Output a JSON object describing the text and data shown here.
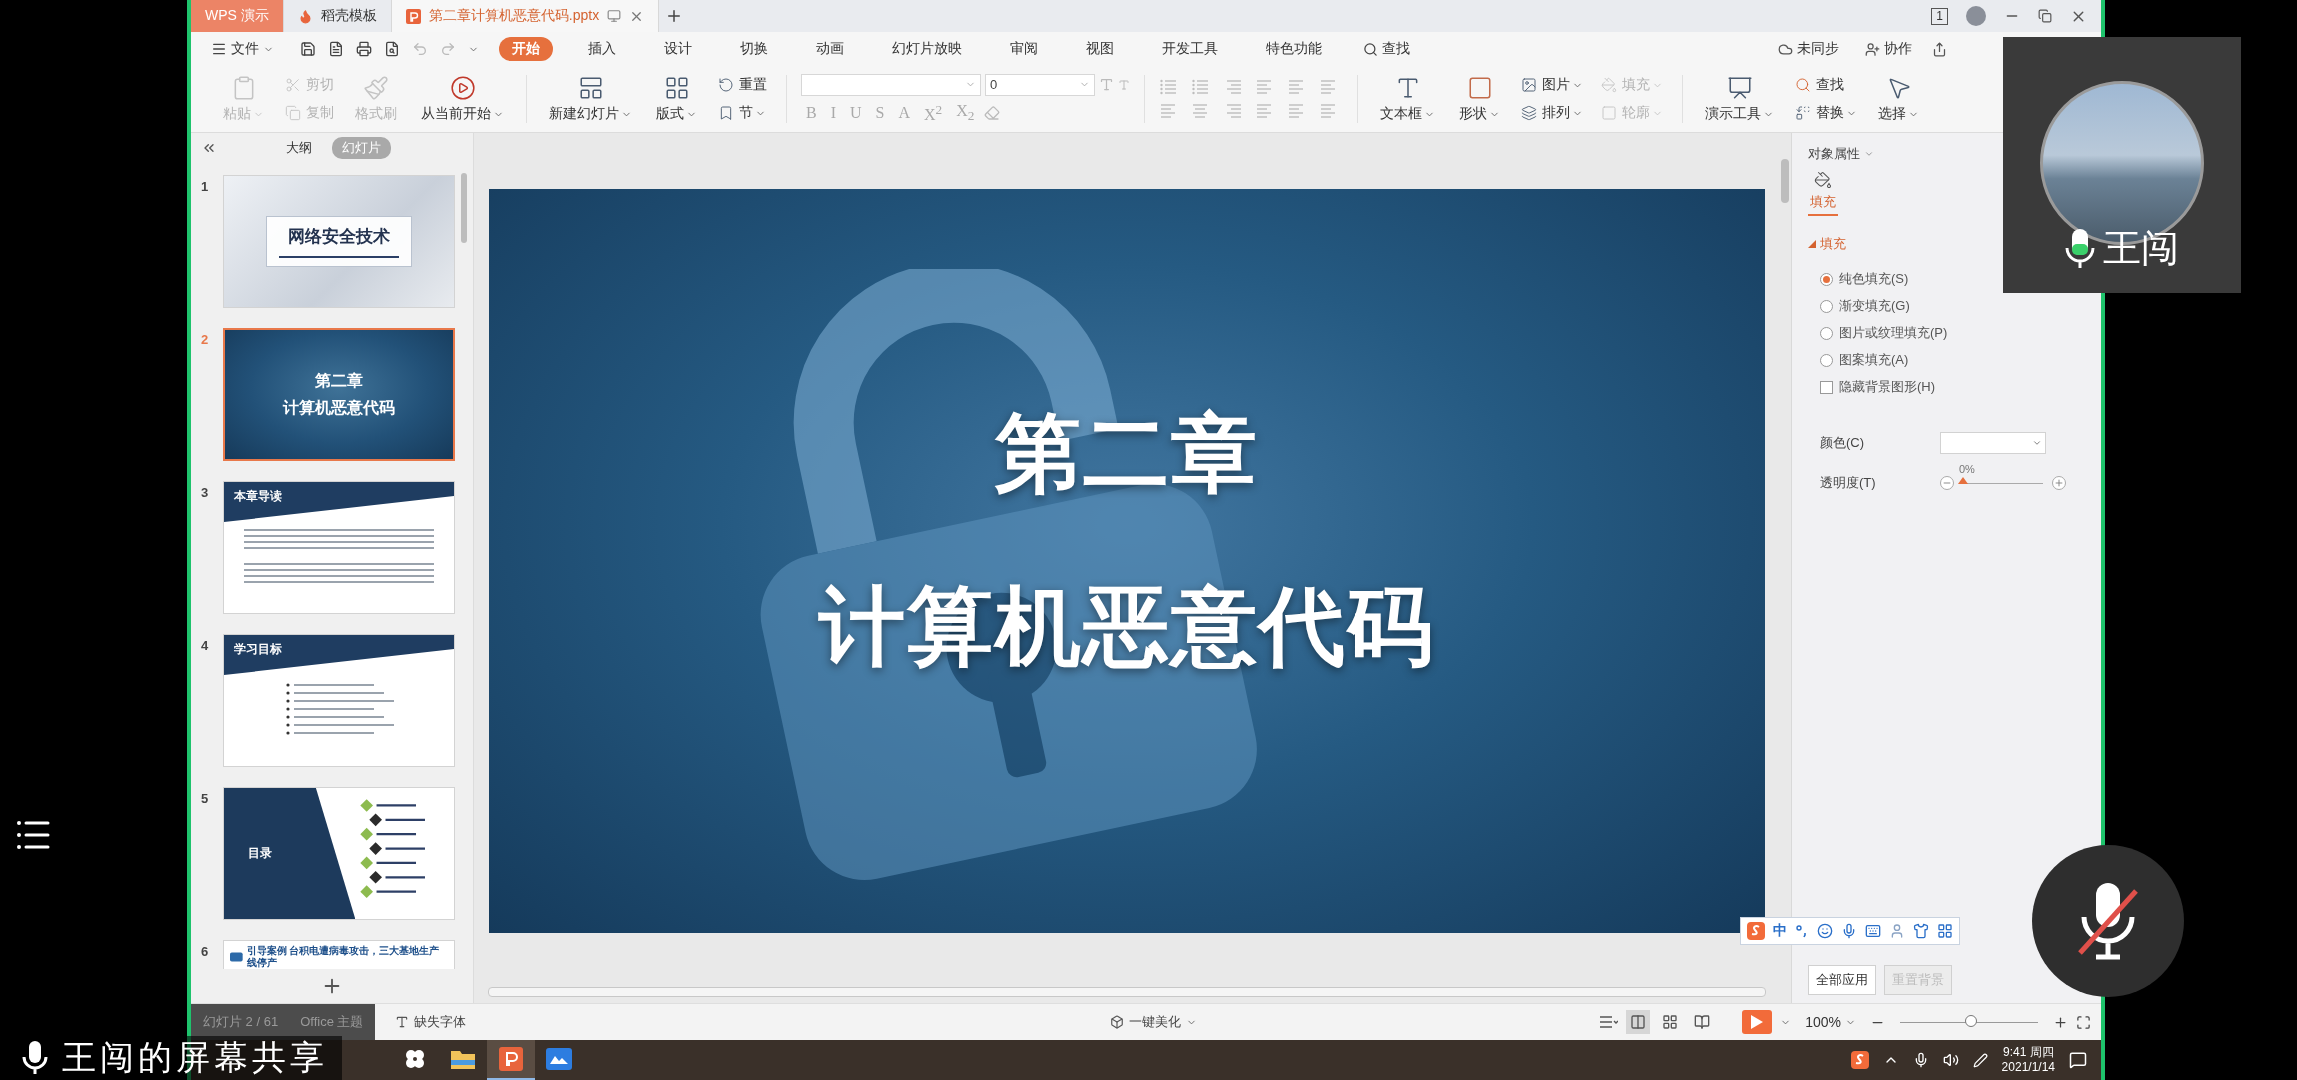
{
  "title_bar": {
    "tabs": [
      {
        "label": "WPS 演示",
        "kind": "app",
        "selected": false
      },
      {
        "label": "稻壳模板",
        "kind": "store",
        "selected": false
      },
      {
        "label": "第二章计算机恶意代码.pptx",
        "kind": "document",
        "selected": true
      }
    ],
    "window_count": "1"
  },
  "menu": {
    "file": "文件",
    "tabs": [
      {
        "label": "开始",
        "selected": true
      },
      {
        "label": "插入",
        "selected": false
      },
      {
        "label": "设计",
        "selected": false
      },
      {
        "label": "切换",
        "selected": false
      },
      {
        "label": "动画",
        "selected": false
      },
      {
        "label": "幻灯片放映",
        "selected": false
      },
      {
        "label": "审阅",
        "selected": false
      },
      {
        "label": "视图",
        "selected": false
      },
      {
        "label": "开发工具",
        "selected": false
      },
      {
        "label": "特色功能",
        "selected": false
      }
    ],
    "search": "查找",
    "sync": "未同步",
    "collaborate": "协作"
  },
  "ribbon": {
    "paste": {
      "label": "粘贴",
      "disabled": true
    },
    "cut": {
      "label": "剪切",
      "disabled": true
    },
    "copy": {
      "label": "复制",
      "disabled": true
    },
    "format_painter": {
      "label": "格式刷",
      "disabled": true
    },
    "play_from_current": {
      "label": "从当前开始",
      "disabled": false
    },
    "new_slide": {
      "label": "新建幻灯片",
      "disabled": false
    },
    "layout": {
      "label": "版式",
      "disabled": false
    },
    "reset": {
      "label": "重置",
      "disabled": false
    },
    "section": {
      "label": "节",
      "disabled": false
    },
    "font_size": {
      "value": "0"
    },
    "format_buttons": [
      {
        "label": "B",
        "disabled": true
      },
      {
        "label": "I",
        "disabled": true
      },
      {
        "label": "U",
        "disabled": true
      },
      {
        "label": "S",
        "disabled": true
      },
      {
        "label": "A",
        "disabled": true
      },
      {
        "label": "X$^{2}$",
        "disabled": true
      },
      {
        "label": "X$_{2}$",
        "disabled": true
      }
    ],
    "paragraph": {
      "disabled": true
    },
    "text_box": {
      "label": "文本框",
      "disabled": false
    },
    "shape": {
      "label": "形状",
      "disabled": false
    },
    "picture": {
      "label": "图片",
      "disabled": false
    },
    "arrange": {
      "label": "排列",
      "disabled": false
    },
    "fill": {
      "label": "填充",
      "disabled": true
    },
    "outline": {
      "label": "轮廓",
      "disabled": true
    },
    "presentation_tools": {
      "label": "演示工具",
      "disabled": false
    },
    "find": {
      "label": "查找",
      "disabled": false
    },
    "replace": {
      "label": "替换",
      "disabled": false
    },
    "select": {
      "label": "选择",
      "disabled": false
    }
  },
  "slides_panel": {
    "tabs": [
      {
        "label": "大纲",
        "selected": false
      },
      {
        "label": "幻灯片",
        "selected": true
      }
    ],
    "slides": [
      {
        "number": "1",
        "kind": "cover",
        "title": "网络安全技术",
        "selected": false
      },
      {
        "number": "2",
        "kind": "chapter",
        "title": "第二章",
        "subtitle": "计算机恶意代码",
        "selected": true
      },
      {
        "number": "3",
        "kind": "text",
        "title": "本章导读",
        "selected": false
      },
      {
        "number": "4",
        "kind": "bullets",
        "title": "学习目标",
        "selected": false
      },
      {
        "number": "5",
        "kind": "contents",
        "title": "目录",
        "selected": false
      },
      {
        "number": "6",
        "kind": "case",
        "title": "引导案例 台积电遭病毒攻击，三大基地生产线停产",
        "selected": false
      }
    ]
  },
  "slide": {
    "title": "第二章",
    "subtitle": "计算机恶意代码"
  },
  "properties_panel": {
    "header": "对象属性",
    "tabs": [
      {
        "label": "填充",
        "selected": true
      }
    ],
    "section": {
      "label": "填充",
      "expanded": true
    },
    "fill_options": [
      {
        "label": "纯色填充(S)",
        "selected": true
      },
      {
        "label": "渐变填充(G)",
        "selected": false
      },
      {
        "label": "图片或纹理填充(P)",
        "selected": false
      },
      {
        "label": "图案填充(A)",
        "selected": false
      }
    ],
    "hide_background": {
      "label": "隐藏背景图形(H)",
      "checked": false
    },
    "color_label": "颜色(C)",
    "transparency": {
      "label": "透明度(T)",
      "reading": "0%",
      "level": 0
    },
    "buttons": [
      {
        "label": "全部应用",
        "disabled": false
      },
      {
        "label": "重置背景",
        "disabled": true
      }
    ]
  },
  "ime_toolbar": {
    "mode": "中"
  },
  "status_bar": {
    "slide_counter": "幻灯片 2 / 61",
    "theme": "Office 主题",
    "missing_fonts": "缺失字体",
    "beautify": "一键美化",
    "views": [
      {
        "kind": "normal",
        "selected": true
      },
      {
        "kind": "sorter",
        "selected": false
      },
      {
        "kind": "reading",
        "selected": false
      }
    ],
    "zoom": {
      "reading": "100%",
      "level": 0.52
    }
  },
  "taskbar": {
    "apps": [
      {
        "kind": "pinwheel",
        "active": false
      },
      {
        "kind": "folder",
        "active": false
      },
      {
        "kind": "presentation",
        "active": true
      },
      {
        "kind": "cloud",
        "active": false
      }
    ],
    "time": "9:41 周四",
    "date": "2021/1/14"
  },
  "call_overlay": {
    "participant": "王闯",
    "share_label": "王闯的屏幕共享",
    "microphone_muted": true
  }
}
